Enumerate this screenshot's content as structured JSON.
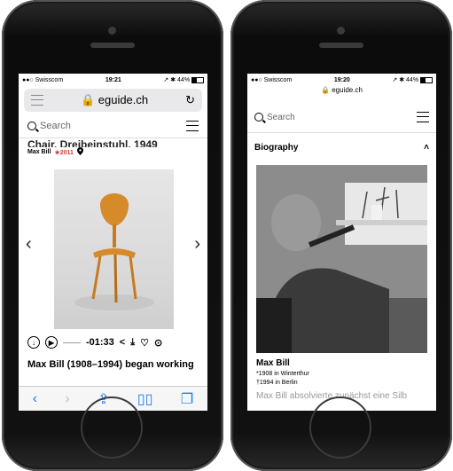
{
  "left": {
    "status": {
      "carrier": "Swisscom",
      "time": "19:21",
      "battery": "44%"
    },
    "url": "eguide.ch",
    "search_placeholder": "Search",
    "object_title": "Chair, Dreibeinstuhl, 1949",
    "designer": "Max Bill",
    "year_badge": "2011",
    "audio_time": "-01:33",
    "bio_intro": "Max Bill (1908–1994) began working"
  },
  "right": {
    "status": {
      "carrier": "Swisscom",
      "time": "19:20",
      "battery": "44%"
    },
    "url": "eguide.ch",
    "search_placeholder": "Search",
    "section_title": "Biography",
    "person_name": "Max Bill",
    "born": "*1908 in Winterthur",
    "died": "†1994 in Berlin",
    "fade_text": "Max Bill absolvierte zunächst eine Silb"
  }
}
